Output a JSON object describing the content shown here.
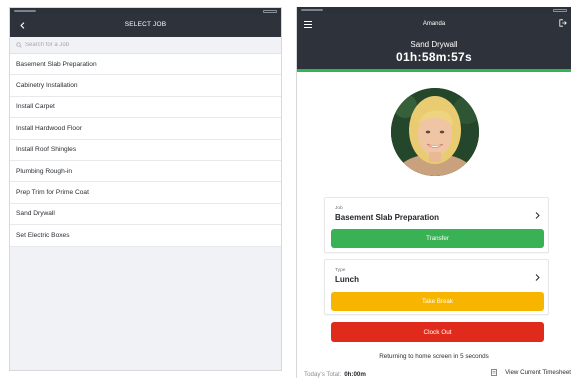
{
  "select_job": {
    "title": "SELECT JOB",
    "search_placeholder": "Search for a Job",
    "jobs": [
      "Basement Slab Preparation",
      "Cabinetry Installation",
      "Install Carpet",
      "Install Hardwood Floor",
      "Install Roof Shingles",
      "Plumbing Rough-in",
      "Prep Trim for Prime Coat",
      "Sand Drywall",
      "Set Electric Boxes"
    ]
  },
  "clock": {
    "user_name": "Amanda",
    "current_job": "Sand Drywall",
    "timer": "01h:58m:57s",
    "job_card": {
      "label": "Job",
      "value": "Basement Slab Preparation",
      "button": "Transfer"
    },
    "type_card": {
      "label": "Type",
      "value": "Lunch",
      "button": "Take Break"
    },
    "clock_out": "Clock Out",
    "return_message": "Returning to home screen in 5 seconds",
    "todays_total_label": "Today's Total:",
    "todays_total_value": "0h:00m",
    "timesheet_link": "View Current Timesheet"
  },
  "icons": {
    "back": "chevron-left-icon",
    "search": "magnifier-icon",
    "menu": "hamburger-menu-icon",
    "logout": "logout-icon",
    "chevron": "chevron-right-icon",
    "timesheet": "document-icon"
  },
  "colors": {
    "header_bg": "#2e323b",
    "accent_green": "#38b255",
    "break_yellow": "#f8b500",
    "clockout_red": "#e02a1c"
  }
}
